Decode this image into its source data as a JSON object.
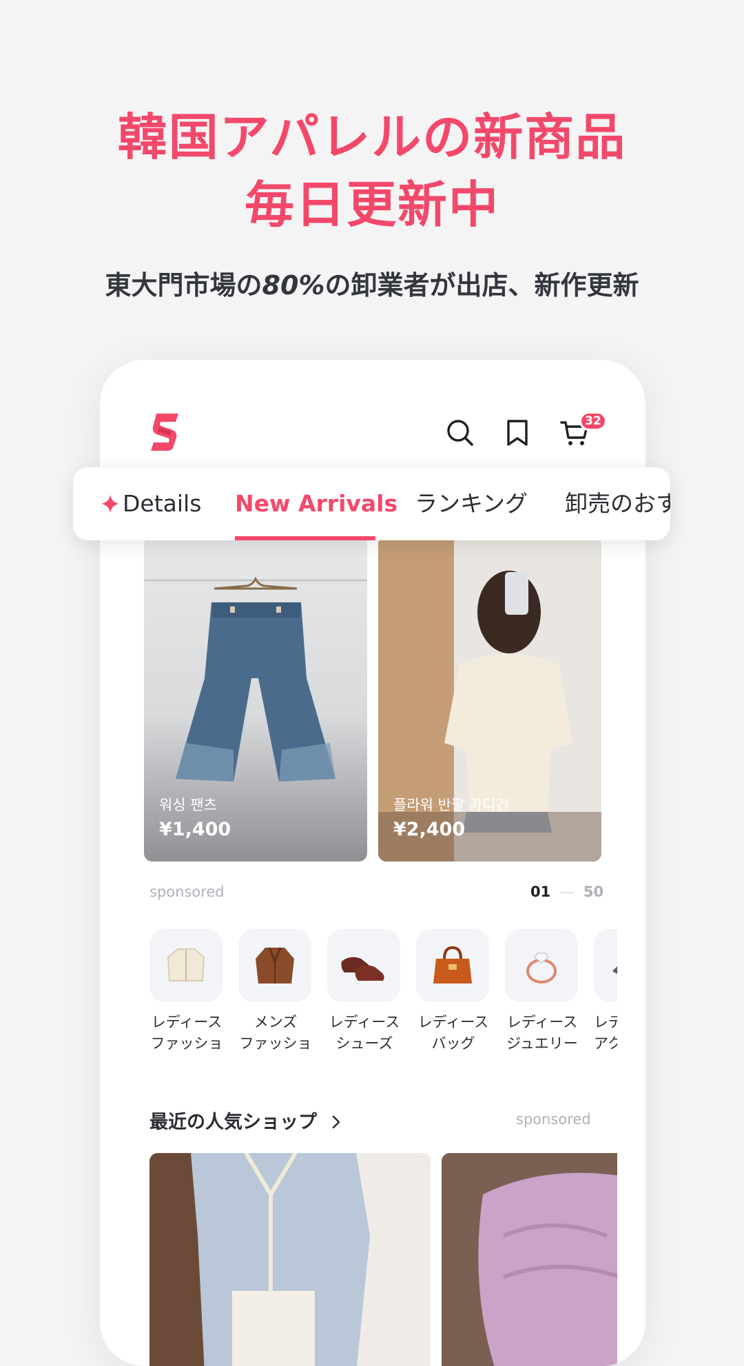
{
  "promo": {
    "headline_line1": "韓国アパレルの新商品",
    "headline_line2": "毎日更新中",
    "subline_prefix": "東大門市場の",
    "subline_percent": "80%",
    "subline_suffix": "の卸業者が出店、新作更新"
  },
  "app": {
    "logo": "S",
    "header_icons": [
      "search-icon",
      "bookmark-icon",
      "cart-icon"
    ],
    "cart_count": "32",
    "accent_color": "#f2496b"
  },
  "tabs": [
    {
      "label": "Details",
      "icon": "sparkle-icon"
    },
    {
      "label": "New Arrivals",
      "active": true
    },
    {
      "label": "ランキング"
    },
    {
      "label": "卸売のおす"
    }
  ],
  "products": [
    {
      "name": "워싱 팬츠",
      "price": "¥1,400"
    },
    {
      "name": "플라워 반팔 가디건",
      "price": "¥2,400"
    }
  ],
  "product_meta": {
    "sponsored": "sponsored",
    "pager_current": "01",
    "pager_total": "50"
  },
  "categories": [
    {
      "line1": "レディース",
      "line2": "ファッショ",
      "icon": "cardigan-icon"
    },
    {
      "line1": "メンズ",
      "line2": "ファッショ",
      "icon": "jacket-icon"
    },
    {
      "line1": "レディース",
      "line2": "シューズ",
      "icon": "shoes-icon"
    },
    {
      "line1": "レディース",
      "line2": "バッグ",
      "icon": "handbag-icon"
    },
    {
      "line1": "レディース",
      "line2": "ジュエリー",
      "icon": "ring-icon"
    },
    {
      "line1": "レデ",
      "line2": "アク",
      "icon": "accessory-icon"
    }
  ],
  "shops": {
    "title": "最近の人気ショップ",
    "sponsored": "sponsored"
  }
}
